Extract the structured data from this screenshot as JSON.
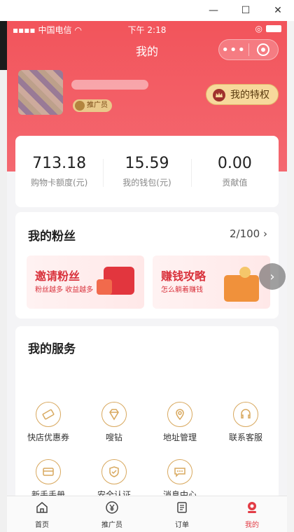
{
  "status": {
    "carrier": "中国电信",
    "time": "下午 2:18"
  },
  "nav": {
    "title": "我的"
  },
  "profile": {
    "role_badge": "推广员",
    "privilege_label": "我的特权"
  },
  "stats": [
    {
      "value": "713.18",
      "label": "购物卡额度(元)"
    },
    {
      "value": "15.59",
      "label": "我的钱包(元)"
    },
    {
      "value": "0.00",
      "label": "贡献值"
    }
  ],
  "fans": {
    "title": "我的粉丝",
    "count": "2/100",
    "promos": [
      {
        "title": "邀请粉丝",
        "subtitle": "粉丝越多 收益越多"
      },
      {
        "title": "赚钱攻略",
        "subtitle": "怎么躺着赚钱"
      }
    ]
  },
  "services": {
    "title": "我的服务",
    "items": [
      {
        "label": "快店优惠券",
        "icon": "coupon-icon"
      },
      {
        "label": "嗖钻",
        "icon": "diamond-icon"
      },
      {
        "label": "地址管理",
        "icon": "location-icon"
      },
      {
        "label": "联系客服",
        "icon": "headset-icon"
      },
      {
        "label": "新手手册",
        "icon": "card-icon"
      },
      {
        "label": "安全认证",
        "icon": "shield-icon"
      },
      {
        "label": "消息中心",
        "icon": "chat-icon"
      }
    ]
  },
  "tabs": [
    {
      "label": "首页",
      "icon": "home-icon"
    },
    {
      "label": "推广员",
      "icon": "yen-icon"
    },
    {
      "label": "订单",
      "icon": "order-icon"
    },
    {
      "label": "我的",
      "icon": "user-icon"
    }
  ],
  "colors": {
    "brand_red": "#f2545b",
    "gold": "#d8a85e",
    "active_tab": "#e23c45"
  }
}
